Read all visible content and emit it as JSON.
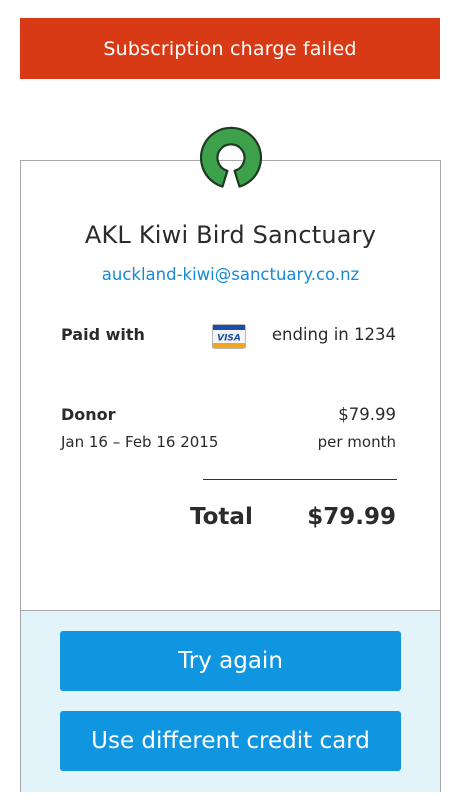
{
  "banner": {
    "message": "Subscription charge failed",
    "color": "#d83a16"
  },
  "merchant": {
    "logo_icon": "open-source-keyhole-logo",
    "name": "AKL Kiwi Bird Sanctuary",
    "email": "auckland-kiwi@sanctuary.co.nz"
  },
  "payment": {
    "label": "Paid with",
    "card_icon": "visa-card-icon",
    "card_brand_text": "VISA",
    "ending_text": "ending in 1234"
  },
  "line_item": {
    "name": "Donor",
    "price": "$79.99",
    "dates": "Jan 16 – Feb 16 2015",
    "period": "per month"
  },
  "total": {
    "label": "Total",
    "amount": "$79.99"
  },
  "actions": {
    "retry_label": "Try again",
    "change_card_label": "Use different credit card",
    "button_color": "#1095e0",
    "panel_color": "#e3f3fa"
  }
}
